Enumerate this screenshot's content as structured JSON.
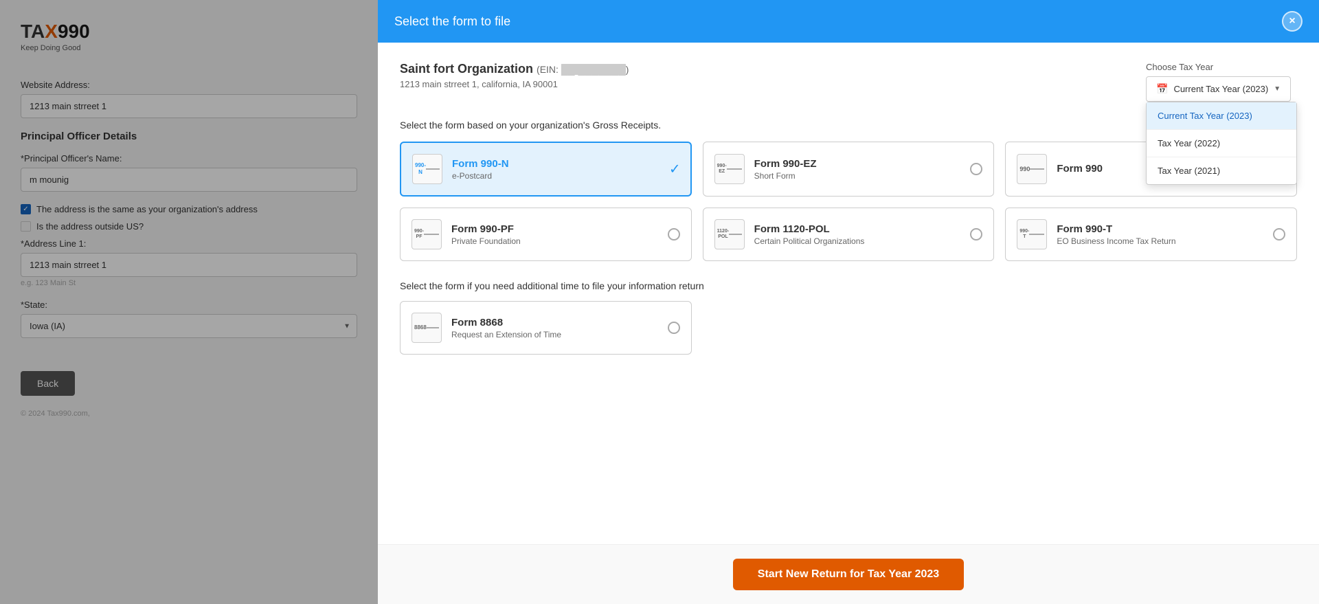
{
  "logo": {
    "text": "TAX990",
    "subtitle": "Keep Doing Good"
  },
  "bg_form": {
    "website_label": "Website Address:",
    "website_value": "1213 main strreet 1",
    "principal_section": "Principal Officer Details",
    "officer_name_label": "*Principal Officer's Name:",
    "officer_name_value": "m mounig",
    "same_address_label": "The address is the same as your organization's address",
    "outside_us_label": "Is the address outside US?",
    "address_line1_label": "*Address Line 1:",
    "address_line1_value": "1213 main strreet 1",
    "address_hint": "e.g. 123 Main St",
    "state_label": "*State:",
    "state_value": "Iowa (IA)",
    "back_btn": "Back",
    "footer": "© 2024 Tax990.com,"
  },
  "modal": {
    "title": "Select the form to file",
    "close_icon": "×",
    "org_name": "Saint fort Organization",
    "ein_label": "EIN:",
    "ein_value": "██-███████",
    "org_address": "1213 main strreet 1, california, IA 90001",
    "tax_year_label": "Choose Tax Year",
    "tax_year_current": "Current Tax Year (2023)",
    "tax_year_options": [
      {
        "label": "Current Tax Year (2023)",
        "selected": true
      },
      {
        "label": "Tax Year (2022)",
        "selected": false
      },
      {
        "label": "Tax Year (2021)",
        "selected": false
      }
    ],
    "gross_receipts_title": "Select the form based on your organization's Gross Receipts.",
    "forms": [
      {
        "id": "990n",
        "icon_label": "990-N",
        "name": "Form 990-N",
        "desc": "e-Postcard",
        "selected": true
      },
      {
        "id": "990ez",
        "icon_label": "990-EZ",
        "name": "Form 990-EZ",
        "desc": "Short Form",
        "selected": false
      },
      {
        "id": "990",
        "icon_label": "990",
        "name": "Form 990",
        "desc": "",
        "selected": false
      },
      {
        "id": "990pf",
        "icon_label": "990-PF",
        "name": "Form 990-PF",
        "desc": "Private Foundation",
        "selected": false
      },
      {
        "id": "1120pol",
        "icon_label": "1120-POL",
        "name": "Form 1120-POL",
        "desc": "Certain Political Organizations",
        "selected": false
      },
      {
        "id": "990t",
        "icon_label": "990-T",
        "name": "Form 990-T",
        "desc": "EO Business Income Tax Return",
        "selected": false
      }
    ],
    "extension_title": "Select the form if you need additional time to file your information return",
    "extension_forms": [
      {
        "id": "8868",
        "icon_label": "8868",
        "name": "Form 8868",
        "desc": "Request an Extension of Time",
        "selected": false
      }
    ],
    "start_btn": "Start New Return for Tax Year 2023"
  }
}
